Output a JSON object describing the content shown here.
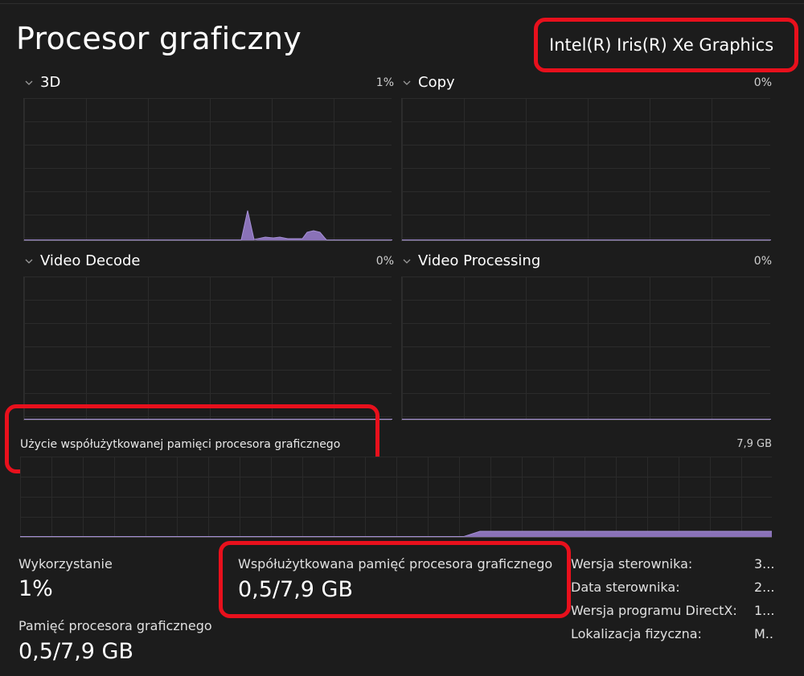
{
  "header": {
    "title": "Procesor graficzny",
    "gpu_name": "Intel(R) Iris(R) Xe Graphics"
  },
  "engines": [
    {
      "name": "3D",
      "percent": "1%"
    },
    {
      "name": "Copy",
      "percent": "0%"
    },
    {
      "name": "Video Decode",
      "percent": "0%"
    },
    {
      "name": "Video Processing",
      "percent": "0%"
    }
  ],
  "shared_memory_chart": {
    "label": "Użycie współużytkowanej pamięci procesora graficznego",
    "max": "7,9 GB"
  },
  "stats": {
    "utilization": {
      "label": "Wykorzystanie",
      "value": "1%"
    },
    "shared_memory": {
      "label": "Współużytkowana pamięć procesora graficznego",
      "value": "0,5/7,9 GB"
    },
    "gpu_memory": {
      "label": "Pamięć procesora graficznego",
      "value": "0,5/7,9 GB"
    }
  },
  "details": [
    {
      "label": "Wersja sterownika:",
      "value": "3..."
    },
    {
      "label": "Data sterownika:",
      "value": "2..."
    },
    {
      "label": "Wersja programu DirectX:",
      "value": "1..."
    },
    {
      "label": "Lokalizacja fizyczna:",
      "value": "M..."
    }
  ],
  "colors": {
    "background": "#1c1c1c",
    "graph_fill": "#8a72b8",
    "graph_line": "#a58fd6",
    "highlight": "#e8101c"
  }
}
